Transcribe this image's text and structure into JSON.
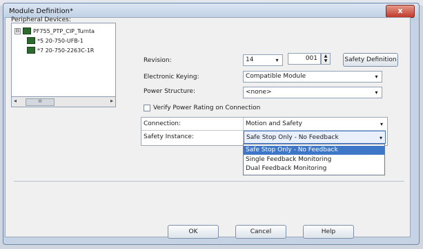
{
  "window": {
    "title": "Module Definition*",
    "close_label": "x"
  },
  "peripheral": {
    "label": "Peripheral Devices:",
    "tree": [
      {
        "expander": "⊟",
        "text": "PF755_PTP_CIP_Turnta"
      },
      {
        "text": "*5 20-750-UFB-1"
      },
      {
        "text": "*7 20-750-2263C-1R"
      }
    ],
    "scroll_left": "◂",
    "scroll_right": "▸",
    "scroll_thumb": "III"
  },
  "form": {
    "revision_label": "Revision:",
    "revision_major": "14",
    "revision_minor": "001",
    "safety_definition_button": "Safety Definition",
    "keying_label": "Electronic Keying:",
    "keying_value": "Compatible Module",
    "power_label": "Power Structure:",
    "power_value": "<none>",
    "verify_label": "Verify Power Rating on Connection"
  },
  "grid": {
    "connection_label": "Connection:",
    "connection_value": "Motion and Safety",
    "safety_instance_label": "Safety Instance:",
    "safety_instance_value": "Safe Stop Only - No Feedback"
  },
  "dropdown_options": [
    "Safe Stop Only - No Feedback",
    "Single Feedback Monitoring",
    "Dual Feedback Monitoring"
  ],
  "dropdown_selected_index": 0,
  "footer": {
    "ok": "OK",
    "cancel": "Cancel",
    "help": "Help"
  },
  "colors": {
    "selection": "#3f77c8",
    "title_bar": "#c6d3e4",
    "close": "#c0382a"
  },
  "icons": {
    "dropdown": "▾",
    "spin_up": "▲",
    "spin_down": "▼"
  }
}
